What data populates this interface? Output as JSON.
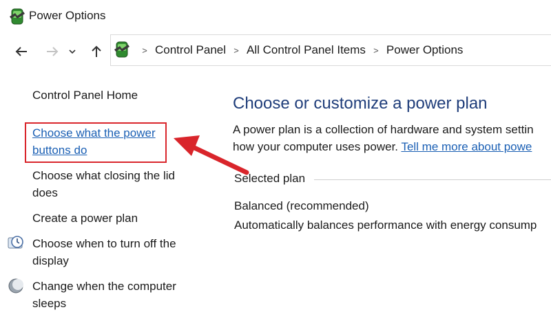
{
  "window": {
    "title": "Power Options"
  },
  "breadcrumb": {
    "items": [
      "Control Panel",
      "All Control Panel Items",
      "Power Options"
    ],
    "separator": ">"
  },
  "nav": {
    "back_icon": "arrow-left-icon",
    "forward_icon": "arrow-right-icon",
    "recent_icon": "chevron-down-icon",
    "up_icon": "arrow-up-icon"
  },
  "sidebar": {
    "home": "Control Panel Home",
    "links": [
      {
        "line1": "Choose what the power",
        "line2": "buttons do",
        "active": true
      },
      {
        "line1": "Choose what closing the lid",
        "line2": "does",
        "active": false
      },
      {
        "line1": "Create a power plan",
        "line2": "",
        "active": false
      },
      {
        "line1": "Choose when to turn off the",
        "line2": "display",
        "active": false,
        "icon": "display-clock-icon"
      },
      {
        "line1": "Change when the computer",
        "line2": "sleeps",
        "active": false,
        "icon": "moon-icon"
      }
    ]
  },
  "main": {
    "title": "Choose or customize a power plan",
    "desc_line1": "A power plan is a collection of hardware and system settin",
    "desc_line2_text": "how your computer uses power. ",
    "desc_link": "Tell me more about powe",
    "group_label": "Selected plan",
    "plan_name": "Balanced (recommended)",
    "plan_desc": "Automatically balances performance with energy consump"
  },
  "colors": {
    "link": "#1a5fb4",
    "heading": "#1f3d7a",
    "annotation": "#d9252b"
  }
}
